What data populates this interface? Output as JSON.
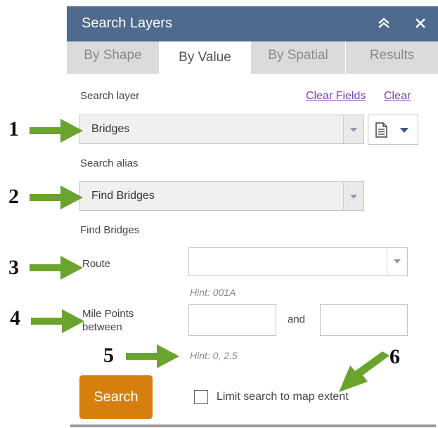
{
  "header": {
    "title": "Search Layers"
  },
  "tabs": [
    {
      "label": "By Shape"
    },
    {
      "label": "By Value"
    },
    {
      "label": "By Spatial"
    },
    {
      "label": "Results"
    }
  ],
  "search_layer": {
    "label": "Search layer",
    "value": "Bridges",
    "clear_fields": "Clear Fields",
    "clear": "Clear"
  },
  "search_alias": {
    "label": "Search alias",
    "value": "Find Bridges"
  },
  "expression": {
    "title": "Find Bridges",
    "route_label": "Route",
    "route_hint": "Hint: 001A",
    "mile_label_1": "Mile Points",
    "mile_label_2": "between",
    "and_label": "and",
    "mile_hint": "Hint: 0, 2.5"
  },
  "actions": {
    "search_label": "Search",
    "limit_label": "Limit search to map extent"
  },
  "callouts": [
    "1",
    "2",
    "3",
    "4",
    "5",
    "6"
  ],
  "colors": {
    "header": "#4e6a8e",
    "search_button": "#d77f0e",
    "arrow": "#6aa32e",
    "link": "#7b3fb5"
  },
  "icons": {
    "collapse": "double-chevron-up-icon",
    "close": "close-icon",
    "document": "document-icon",
    "dropdown": "caret-down-icon"
  }
}
